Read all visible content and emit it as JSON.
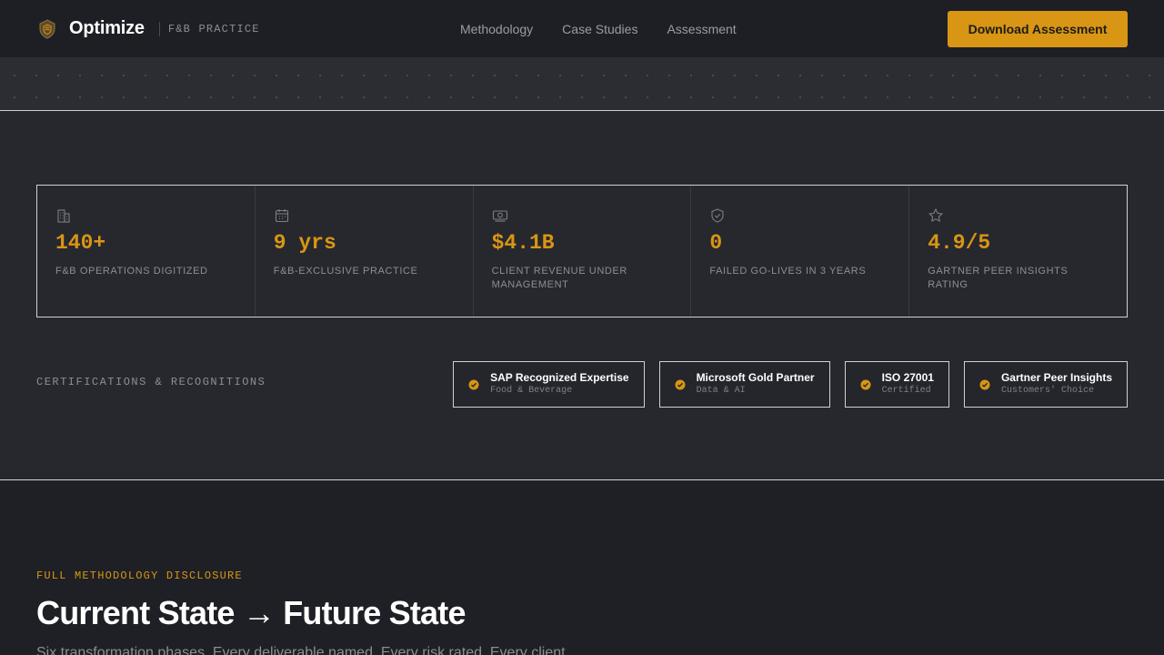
{
  "header": {
    "brand_name": "Optimize",
    "brand_tag": "F&B PRACTICE",
    "nav": [
      "Methodology",
      "Case Studies",
      "Assessment"
    ],
    "cta_label": "Download Assessment"
  },
  "stats": [
    {
      "icon": "building-icon",
      "value": "140+",
      "label": "F&B OPERATIONS DIGITIZED"
    },
    {
      "icon": "calendar-icon",
      "value": "9 yrs",
      "label": "F&B-EXCLUSIVE PRACTICE"
    },
    {
      "icon": "money-icon",
      "value": "$4.1B",
      "label": "CLIENT REVENUE UNDER MANAGEMENT"
    },
    {
      "icon": "shield-check-icon",
      "value": "0",
      "label": "FAILED GO-LIVES IN 3 YEARS"
    },
    {
      "icon": "star-icon",
      "value": "4.9/5",
      "label": "GARTNER PEER INSIGHTS RATING"
    }
  ],
  "certifications": {
    "label": "CERTIFICATIONS & RECOGNITIONS",
    "items": [
      {
        "title": "SAP Recognized Expertise",
        "sub": "Food & Beverage"
      },
      {
        "title": "Microsoft Gold Partner",
        "sub": "Data & AI"
      },
      {
        "title": "ISO 27001",
        "sub": "Certified"
      },
      {
        "title": "Gartner Peer Insights",
        "sub": "Customers' Choice"
      }
    ]
  },
  "methodology": {
    "kicker": "FULL METHODOLOGY DISCLOSURE",
    "title": "Current State → Future State",
    "description": "Six transformation phases. Every deliverable named. Every risk rated. Every client"
  },
  "colors": {
    "accent": "#d99514",
    "background": "#24262c",
    "header": "#1d1f24"
  }
}
